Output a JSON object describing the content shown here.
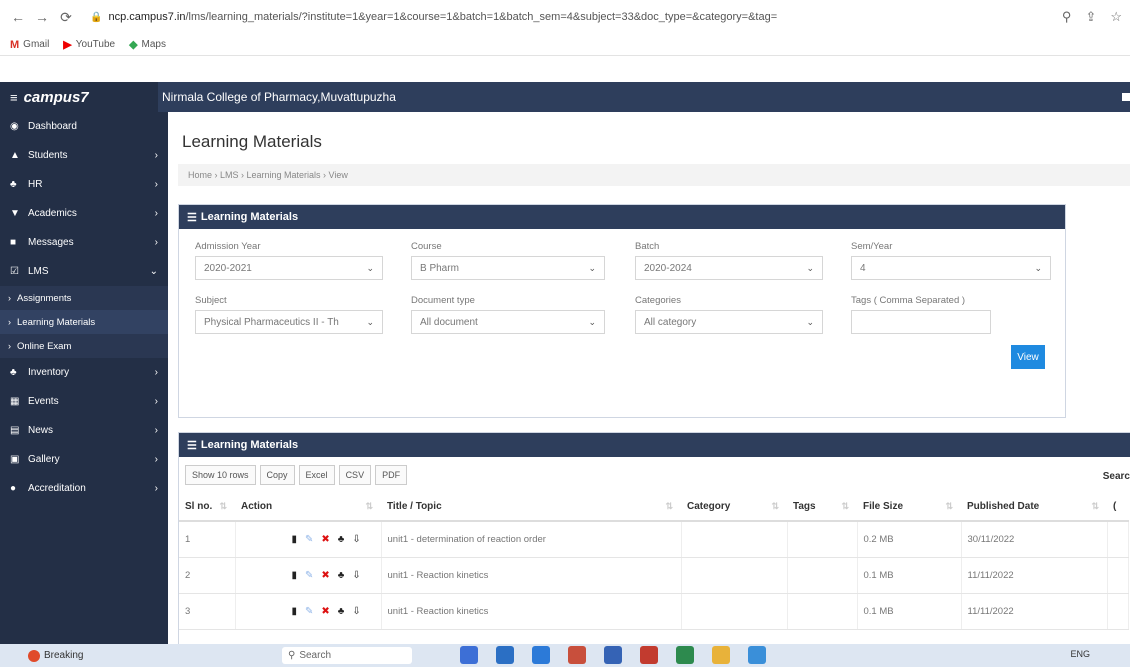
{
  "browser": {
    "url_host": "ncp.campus7.in",
    "url_path": "/lms/learning_materials/?institute=1&year=1&course=1&batch=1&batch_sem=4&subject=33&doc_type=&category=&tag=",
    "bookmarks": [
      {
        "label": "Gmail",
        "icon": "gmail-icon"
      },
      {
        "label": "YouTube",
        "icon": "youtube-icon"
      },
      {
        "label": "Maps",
        "icon": "maps-icon"
      }
    ]
  },
  "app": {
    "brand": "campus7",
    "college": "Nirmala College of Pharmacy,Muvattupuzha"
  },
  "sidebar": {
    "items": [
      {
        "label": "Dashboard",
        "icon": "dashboard-icon",
        "chevron": false
      },
      {
        "label": "Students",
        "icon": "user-icon",
        "chevron": true
      },
      {
        "label": "HR",
        "icon": "group-icon",
        "chevron": true
      },
      {
        "label": "Academics",
        "icon": "cap-icon",
        "chevron": true
      },
      {
        "label": "Messages",
        "icon": "envelope-icon",
        "chevron": true
      },
      {
        "label": "LMS",
        "icon": "check-icon",
        "chevron": true
      }
    ],
    "lms_sub": [
      "Assignments",
      "Learning Materials",
      "Online Exam"
    ],
    "items_after": [
      {
        "label": "Inventory",
        "icon": "people-icon",
        "chevron": true
      },
      {
        "label": "Events",
        "icon": "calendar-icon",
        "chevron": true
      },
      {
        "label": "News",
        "icon": "news-icon",
        "chevron": true
      },
      {
        "label": "Gallery",
        "icon": "image-icon",
        "chevron": true
      },
      {
        "label": "Accreditation",
        "icon": "circle-icon",
        "chevron": true
      }
    ]
  },
  "page": {
    "title": "Learning Materials",
    "breadcrumb": "Home › LMS › Learning Materials › View"
  },
  "filter_panel": {
    "title": "Learning Materials",
    "fields": {
      "admission_year": {
        "label": "Admission Year",
        "value": "2020-2021"
      },
      "course": {
        "label": "Course",
        "value": "B Pharm"
      },
      "batch": {
        "label": "Batch",
        "value": "2020-2024"
      },
      "sem": {
        "label": "Sem/Year",
        "value": "4"
      },
      "subject": {
        "label": "Subject",
        "value": "Physical Pharmaceutics II - Th"
      },
      "doc_type": {
        "label": "Document type",
        "value": "All document"
      },
      "categories": {
        "label": "Categories",
        "value": "All category"
      },
      "tags": {
        "label": "Tags ( Comma Separated )",
        "value": ""
      }
    },
    "view_label": "View"
  },
  "table_panel": {
    "title": "Learning Materials",
    "tools": [
      "Show 10 rows",
      "Copy",
      "Excel",
      "CSV",
      "PDF"
    ],
    "search_label": "Searc",
    "columns": [
      "Sl no.",
      "Action",
      "Title / Topic",
      "Category",
      "Tags",
      "File Size",
      "Published Date",
      "("
    ],
    "rows": [
      {
        "sl": "1",
        "title": "unit1 - determination of reaction order",
        "category": "",
        "tags": "",
        "size": "0.2 MB",
        "date": "30/11/2022"
      },
      {
        "sl": "2",
        "title": "unit1 - Reaction kinetics",
        "category": "",
        "tags": "",
        "size": "0.1 MB",
        "date": "11/11/2022"
      },
      {
        "sl": "3",
        "title": "unit1 - Reaction kinetics",
        "category": "",
        "tags": "",
        "size": "0.1 MB",
        "date": "11/11/2022"
      }
    ]
  },
  "taskbar": {
    "news": "Breaking",
    "search": "Search",
    "lang": "ENG"
  },
  "colors": {
    "sidebar": "#232f46",
    "header": "#2e3e5c",
    "accent": "#1f8ae0",
    "arrow": "#c0151b"
  }
}
